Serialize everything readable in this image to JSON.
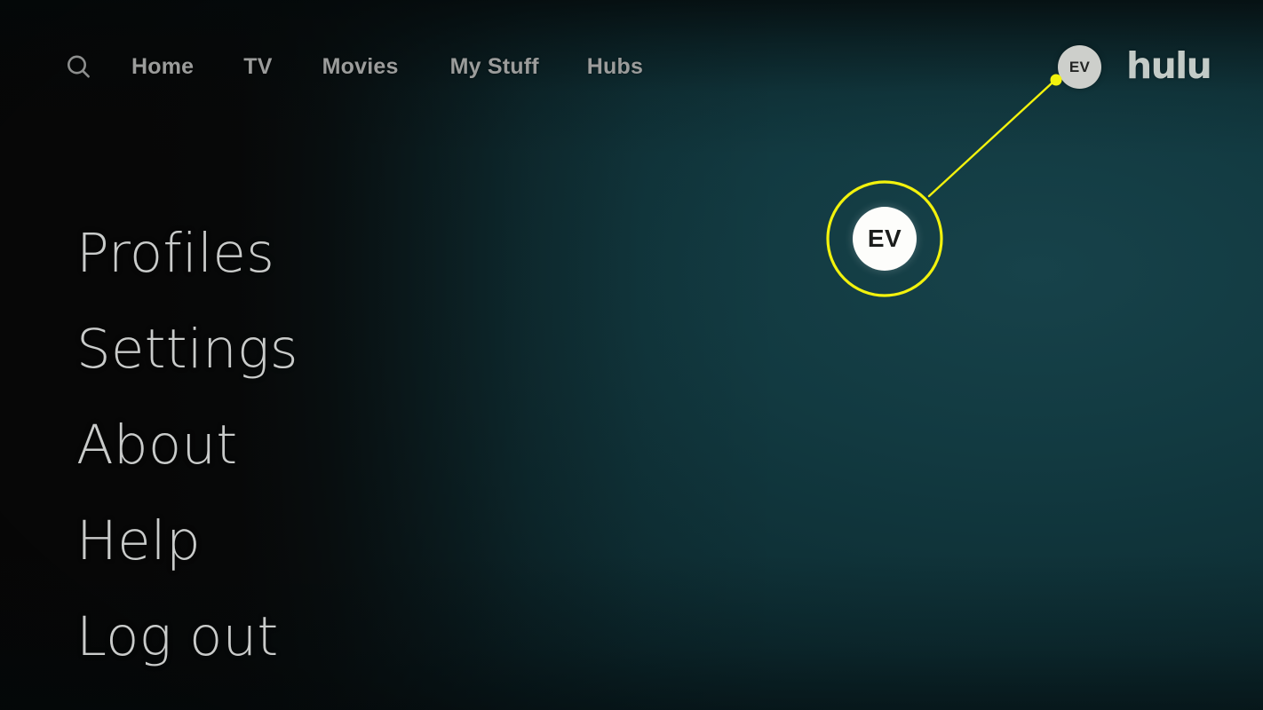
{
  "app": {
    "name": "Hulu",
    "logo_text": "hulu",
    "accent_color": "#f2f20d",
    "background_colors": {
      "left": "#070707",
      "mid": "#0e2328",
      "right": "#17424a",
      "bottom_right": "#0d2428"
    }
  },
  "topnav": {
    "search_icon": "search-icon",
    "items": [
      {
        "label": "Home"
      },
      {
        "label": "TV"
      },
      {
        "label": "Movies"
      },
      {
        "label": "My Stuff"
      },
      {
        "label": "Hubs"
      }
    ],
    "avatar": {
      "initials": "EV",
      "bg_color": "#cdcfcb",
      "text_color": "#232524"
    }
  },
  "menu": {
    "items": [
      {
        "label": "Profiles"
      },
      {
        "label": "Settings"
      },
      {
        "label": "About"
      },
      {
        "label": "Help"
      },
      {
        "label": "Log out"
      }
    ]
  },
  "callout": {
    "color": "#f2f20d",
    "magnified_avatar": {
      "initials": "EV",
      "bg_color": "#fdfdfb",
      "text_color": "#1b1d1c"
    }
  }
}
